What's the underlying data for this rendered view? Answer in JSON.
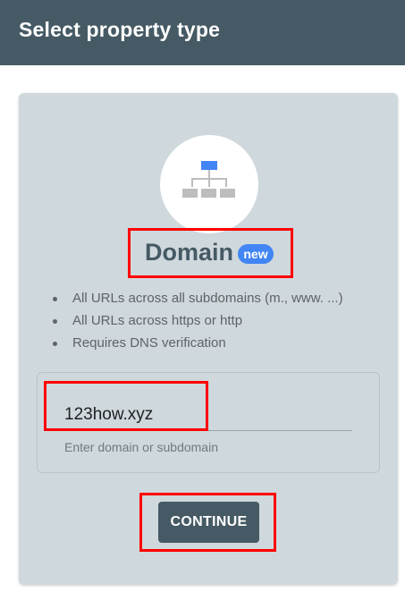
{
  "header": {
    "title": "Select property type"
  },
  "card": {
    "icon": "sitemap-icon",
    "title": "Domain",
    "badge": "new",
    "bullets": [
      "All URLs across all subdomains (m., www. ...)",
      "All URLs across https or http",
      "Requires DNS verification"
    ],
    "input": {
      "value": "123how.xyz",
      "helper": "Enter domain or subdomain"
    },
    "continue_label": "CONTINUE"
  },
  "colors": {
    "header_bg": "#455a64",
    "card_bg": "#cfd8dc",
    "badge_bg": "#4285f4",
    "icon_top_node": "#4285f4",
    "icon_nodes": "#bdbdbd",
    "button_bg": "#455a64",
    "highlight": "#ff0000"
  }
}
